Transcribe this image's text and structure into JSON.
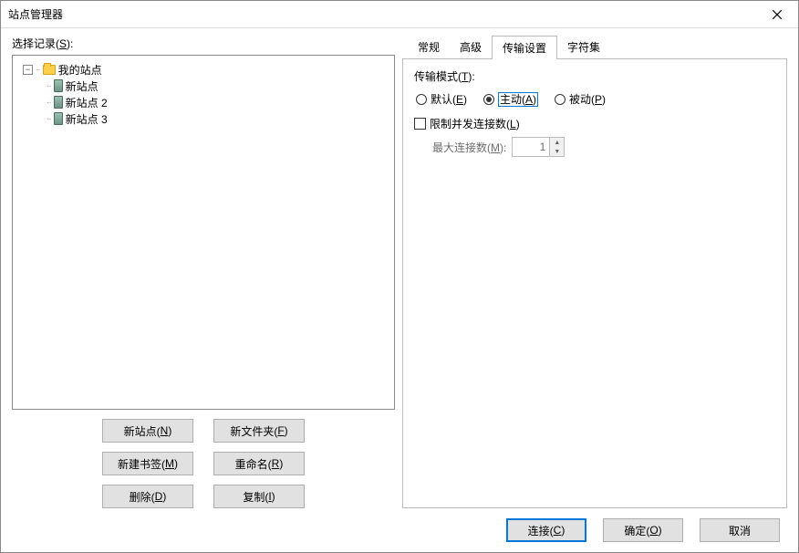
{
  "window": {
    "title": "站点管理器"
  },
  "leftPane": {
    "selectLabel": "选择记录(S):",
    "tree": {
      "rootLabel": "我的站点",
      "items": [
        "新站点",
        "新站点 2",
        "新站点 3"
      ]
    },
    "buttons": {
      "newSite": "新站点(N)",
      "newFolder": "新文件夹(F)",
      "newBookmark": "新建书签(M)",
      "rename": "重命名(R)",
      "delete": "删除(D)",
      "copy": "复制(I)"
    }
  },
  "tabs": {
    "general": "常规",
    "advanced": "高级",
    "transfer": "传输设置",
    "charset": "字符集"
  },
  "transferPanel": {
    "modeLabel": "传输模式(T):",
    "radioDefault": "默认(E)",
    "radioActive": "主动(A)",
    "radioPassive": "被动(P)",
    "limitLabel": "限制并发连接数(L)",
    "maxConnLabel": "最大连接数(M):",
    "maxConnValue": "1"
  },
  "footer": {
    "connect": "连接(C)",
    "ok": "确定(O)",
    "cancel": "取消"
  }
}
